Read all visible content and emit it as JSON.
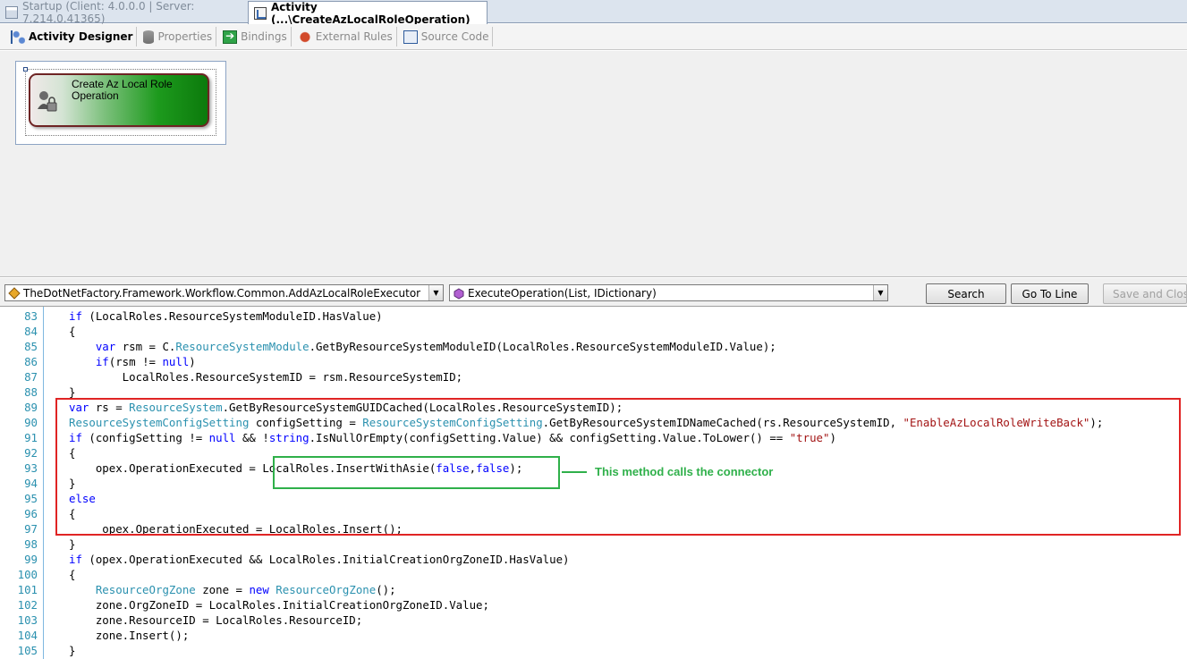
{
  "tabs": [
    {
      "label": "Startup (Client: 4.0.0.0 | Server: 7.214.0.41365)"
    },
    {
      "label": "Activity (...\\CreateAzLocalRoleOperation)"
    }
  ],
  "designer_tabs": [
    {
      "label": "Activity Designer"
    },
    {
      "label": "Properties"
    },
    {
      "label": "Bindings"
    },
    {
      "label": "External Rules"
    },
    {
      "label": "Source Code"
    }
  ],
  "activity": {
    "label": "Create Az Local Role Operation"
  },
  "code_toolbar": {
    "class_combo": "TheDotNetFactory.Framework.Workflow.Common.AddAzLocalRoleExecutor",
    "method_combo": "ExecuteOperation(List, IDictionary)",
    "search_label": "Search",
    "goto_label": "Go To Line",
    "save_label": "Save and Close"
  },
  "code": [
    {
      "n": "83",
      "text": "if (LocalRoles.ResourceSystemModuleID.HasValue)"
    },
    {
      "n": "84",
      "text": "{"
    },
    {
      "n": "85",
      "text": "    var rsm = C.ResourceSystemModule.GetByResourceSystemModuleID(LocalRoles.ResourceSystemModuleID.Value);"
    },
    {
      "n": "86",
      "text": "    if(rsm != null)"
    },
    {
      "n": "87",
      "text": "        LocalRoles.ResourceSystemID = rsm.ResourceSystemID;"
    },
    {
      "n": "88",
      "text": "}"
    },
    {
      "n": "89",
      "text": "var rs = ResourceSystem.GetByResourceSystemGUIDCached(LocalRoles.ResourceSystemID);"
    },
    {
      "n": "90",
      "text": "ResourceSystemConfigSetting configSetting = ResourceSystemConfigSetting.GetByResourceSystemIDNameCached(rs.ResourceSystemID, \"EnableAzLocalRoleWriteBack\");"
    },
    {
      "n": "91",
      "text": "if (configSetting != null && !string.IsNullOrEmpty(configSetting.Value) && configSetting.Value.ToLower() == \"true\")"
    },
    {
      "n": "92",
      "text": "{"
    },
    {
      "n": "93",
      "text": "    opex.OperationExecuted = LocalRoles.InsertWithAsie(false,false);"
    },
    {
      "n": "94",
      "text": "}"
    },
    {
      "n": "95",
      "text": "else"
    },
    {
      "n": "96",
      "text": "{"
    },
    {
      "n": "97",
      "text": "     opex.OperationExecuted = LocalRoles.Insert();"
    },
    {
      "n": "98",
      "text": "}"
    },
    {
      "n": "99",
      "text": "if (opex.OperationExecuted && LocalRoles.InitialCreationOrgZoneID.HasValue)"
    },
    {
      "n": "100",
      "text": "{"
    },
    {
      "n": "101",
      "text": "    ResourceOrgZone zone = new ResourceOrgZone();"
    },
    {
      "n": "102",
      "text": "    zone.OrgZoneID = LocalRoles.InitialCreationOrgZoneID.Value;"
    },
    {
      "n": "103",
      "text": "    zone.ResourceID = LocalRoles.ResourceID;"
    },
    {
      "n": "104",
      "text": "    zone.Insert();"
    },
    {
      "n": "105",
      "text": "}"
    }
  ],
  "annotation": "This method calls the connector",
  "colors": {
    "highlight_box": "#e02424",
    "callout_box": "#2fb04a",
    "keyword": "#0000ff",
    "type": "#2b91af",
    "string": "#a31515"
  }
}
